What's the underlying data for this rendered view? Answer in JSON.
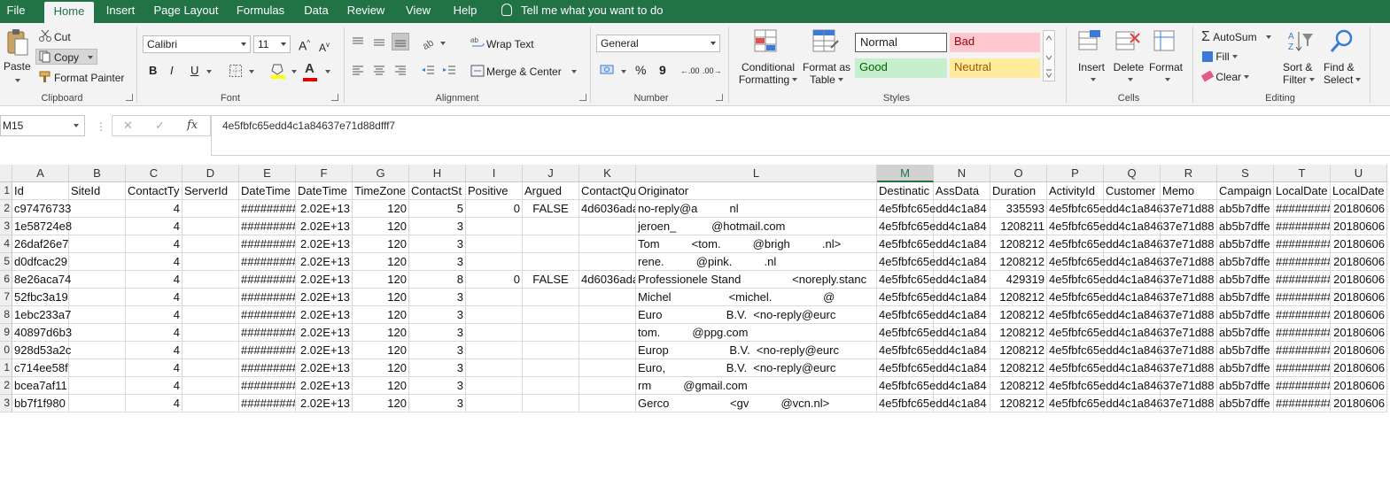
{
  "menu": {
    "tabs": [
      "File",
      "Home",
      "Insert",
      "Page Layout",
      "Formulas",
      "Data",
      "Review",
      "View",
      "Help"
    ],
    "active": "Home",
    "tell_me": "Tell me what you want to do"
  },
  "ribbon": {
    "clipboard": {
      "label": "Clipboard",
      "paste": "Paste",
      "cut": "Cut",
      "copy": "Copy",
      "format_painter": "Format Painter"
    },
    "font": {
      "label": "Font",
      "name": "Calibri",
      "size": "11",
      "bold": "B",
      "italic": "I",
      "underline": "U",
      "grow": "A",
      "shrink": "A",
      "color_a": "A"
    },
    "alignment": {
      "label": "Alignment",
      "wrap_text": "Wrap Text",
      "merge_center": "Merge & Center"
    },
    "number": {
      "label": "Number",
      "format": "General",
      "percent": "%",
      "comma": "9",
      "inc_dec": "←.00",
      "dec_dec": ".00→"
    },
    "styles": {
      "label": "Styles",
      "conditional": [
        "Conditional",
        "Formatting"
      ],
      "format_as": [
        "Format as",
        "Table"
      ],
      "normal": "Normal",
      "bad": "Bad",
      "good": "Good",
      "neutral": "Neutral"
    },
    "cells": {
      "label": "Cells",
      "insert": "Insert",
      "delete": "Delete",
      "format": "Format"
    },
    "editing": {
      "label": "Editing",
      "autosum": "AutoSum",
      "fill": "Fill",
      "clear": "Clear",
      "sort": [
        "Sort &",
        "Filter"
      ],
      "find": [
        "Find &",
        "Select"
      ]
    }
  },
  "formula_bar": {
    "name_box": "M15",
    "cancel": "✕",
    "enter": "✓",
    "fx": "fx",
    "value": "4e5fbfc65edd4c1a84637e71d88dfff7"
  },
  "colors": {
    "excel_green": "#217346",
    "bad_bg": "#ffc7ce",
    "good_bg": "#c6efce",
    "neutral_bg": "#ffeb9c"
  },
  "sheet": {
    "columns": [
      "A",
      "B",
      "C",
      "D",
      "E",
      "F",
      "G",
      "H",
      "I",
      "J",
      "K",
      "L",
      "M",
      "N",
      "O",
      "P",
      "Q",
      "R",
      "S",
      "T",
      "U"
    ],
    "selected_column": "M",
    "row_numbers": [
      "1",
      "2",
      "3",
      "4",
      "5",
      "6",
      "7",
      "8",
      "9",
      "0",
      "1",
      "2",
      "3"
    ],
    "header": [
      "Id",
      "SiteId",
      "ContactTy",
      "ServerId",
      "DateTime",
      "DateTime",
      "TimeZone",
      "ContactSt",
      "Positive",
      "Argued",
      "ContactQu",
      "Originator",
      "Destinatic",
      "AssData",
      "Duration",
      "ActivityId",
      "Customer",
      "Memo",
      "Campaign",
      "LocalDate",
      "LocalDate"
    ],
    "rows": [
      [
        "c97476733",
        "",
        "4",
        "",
        "#########",
        "2.02E+13",
        "120",
        "5",
        "0",
        "FALSE",
        "4d6036ada",
        "no-reply@a          nl",
        "4e5fbfc65edd4c1a84",
        "",
        "335593",
        "4e5fbfc65edd4c1a84637e71d88",
        "",
        "",
        "ab5b7dffe",
        "#########",
        "20180606"
      ],
      [
        "1e58724e8",
        "",
        "4",
        "",
        "#########",
        "2.02E+13",
        "120",
        "3",
        "",
        "",
        "",
        "jeroen_           @hotmail.com",
        "4e5fbfc65edd4c1a84",
        "",
        "1208211",
        "4e5fbfc65edd4c1a84637e71d88",
        "",
        "",
        "ab5b7dffe",
        "#########",
        "20180606"
      ],
      [
        "26daf26e7",
        "",
        "4",
        "",
        "#########",
        "2.02E+13",
        "120",
        "3",
        "",
        "",
        "",
        "Tom          <tom.          @brigh          .nl>",
        "4e5fbfc65edd4c1a84",
        "",
        "1208212",
        "4e5fbfc65edd4c1a84637e71d88",
        "",
        "",
        "ab5b7dffe",
        "#########",
        "20180606"
      ],
      [
        "d0dfcac29",
        "",
        "4",
        "",
        "#########",
        "2.02E+13",
        "120",
        "3",
        "",
        "",
        "",
        "rene.          @pink.          .nl",
        "4e5fbfc65edd4c1a84",
        "",
        "1208212",
        "4e5fbfc65edd4c1a84637e71d88",
        "",
        "",
        "ab5b7dffe",
        "#########",
        "20180606"
      ],
      [
        "8e26aca74",
        "",
        "4",
        "",
        "#########",
        "2.02E+13",
        "120",
        "8",
        "0",
        "FALSE",
        "4d6036ada",
        "Professionele Stand                <noreply.stanc",
        "4e5fbfc65edd4c1a84",
        "",
        "429319",
        "4e5fbfc65edd4c1a84637e71d88",
        "",
        "",
        "ab5b7dffe",
        "#########",
        "20180606"
      ],
      [
        "52fbc3a19",
        "",
        "4",
        "",
        "#########",
        "2.02E+13",
        "120",
        "3",
        "",
        "",
        "",
        "Michel                  <michel.                @",
        "4e5fbfc65edd4c1a84",
        "",
        "1208212",
        "4e5fbfc65edd4c1a84637e71d88",
        "",
        "",
        "ab5b7dffe",
        "#########",
        "20180606"
      ],
      [
        "1ebc233a7",
        "",
        "4",
        "",
        "#########",
        "2.02E+13",
        "120",
        "3",
        "",
        "",
        "",
        "Euro                    B.V.  <no-reply@eurc",
        "4e5fbfc65edd4c1a84",
        "",
        "1208212",
        "4e5fbfc65edd4c1a84637e71d88",
        "",
        "",
        "ab5b7dffe",
        "#########",
        "20180606"
      ],
      [
        "40897d6b3",
        "",
        "4",
        "",
        "#########",
        "2.02E+13",
        "120",
        "3",
        "",
        "",
        "",
        "tom.          @ppg.com",
        "4e5fbfc65edd4c1a84",
        "",
        "1208212",
        "4e5fbfc65edd4c1a84637e71d88",
        "",
        "",
        "ab5b7dffe",
        "#########",
        "20180606"
      ],
      [
        "928d53a2c",
        "",
        "4",
        "",
        "#########",
        "2.02E+13",
        "120",
        "3",
        "",
        "",
        "",
        "Europ                   B.V.  <no-reply@eurc",
        "4e5fbfc65edd4c1a84",
        "",
        "1208212",
        "4e5fbfc65edd4c1a84637e71d88",
        "",
        "",
        "ab5b7dffe",
        "#########",
        "20180606"
      ],
      [
        "c714ee58f",
        "",
        "4",
        "",
        "#########",
        "2.02E+13",
        "120",
        "3",
        "",
        "",
        "",
        "Euro,                   B.V.  <no-reply@eurc",
        "4e5fbfc65edd4c1a84",
        "",
        "1208212",
        "4e5fbfc65edd4c1a84637e71d88",
        "",
        "",
        "ab5b7dffe",
        "#########",
        "20180606"
      ],
      [
        "bcea7af11",
        "",
        "4",
        "",
        "#########",
        "2.02E+13",
        "120",
        "3",
        "",
        "",
        "",
        "rm          @gmail.com",
        "4e5fbfc65edd4c1a84",
        "",
        "1208212",
        "4e5fbfc65edd4c1a84637e71d88",
        "",
        "",
        "ab5b7dffe",
        "#########",
        "20180606"
      ],
      [
        "bb7f1f980",
        "",
        "4",
        "",
        "#########",
        "2.02E+13",
        "120",
        "3",
        "",
        "",
        "",
        "Gerco                   <gv          @vcn.nl>",
        "4e5fbfc65edd4c1a84",
        "",
        "1208212",
        "4e5fbfc65edd4c1a84637e71d88",
        "",
        "",
        "ab5b7dffe",
        "#########",
        "20180606"
      ]
    ]
  }
}
